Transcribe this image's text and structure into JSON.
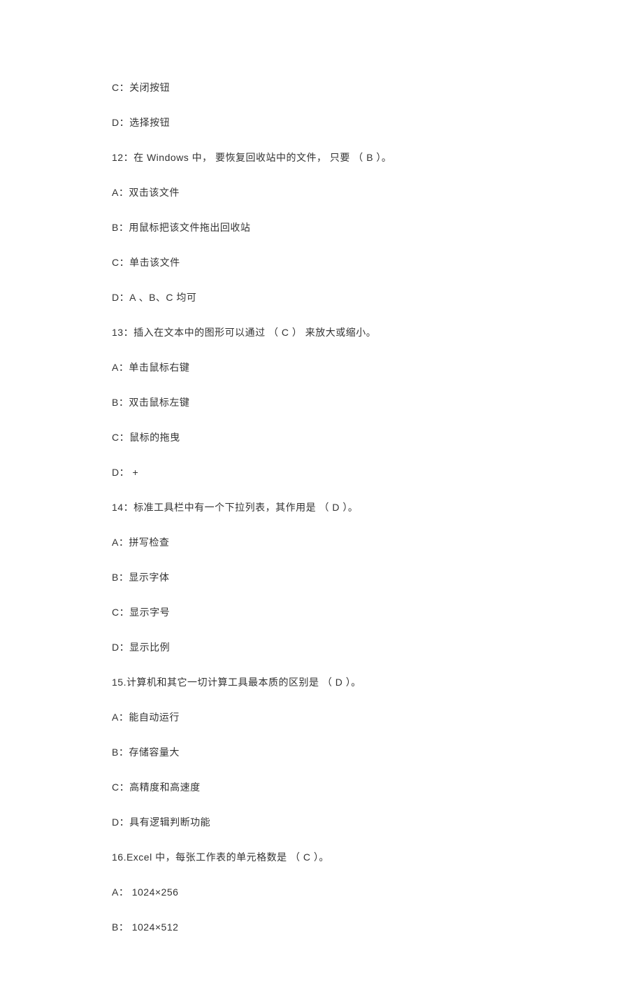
{
  "lines": [
    "C：关闭按钮",
    "D：选择按钮",
    "12：在 Windows   中，   要恢复回收站中的文件，     只要   （ B ）。",
    "A：双击该文件",
    "B：用鼠标把该文件拖出回收站",
    "C：单击该文件",
    "D：A 、B、C 均可",
    "13：插入在文本中的图形可以通过      （ C ）  来放大或缩小。",
    "A：单击鼠标右键",
    "B：双击鼠标左键",
    "C：鼠标的拖曳",
    "D：   +",
    "14：标准工具栏中有一个下拉列表，其作用是       （ D  ）。",
    "A：拼写检查",
    "B：显示字体",
    "C：显示字号",
    "D：显示比例",
    "15.计算机和其它一切计算工具最本质的区别是       （ D  ）。",
    "A：能自动运行",
    "B：存储容量大",
    "C：高精度和高速度",
    "D：具有逻辑判断功能",
    "16.Excel 中，每张工作表的单元格数是      （ C  ）。",
    "A： 1024×256",
    "B： 1024×512"
  ]
}
